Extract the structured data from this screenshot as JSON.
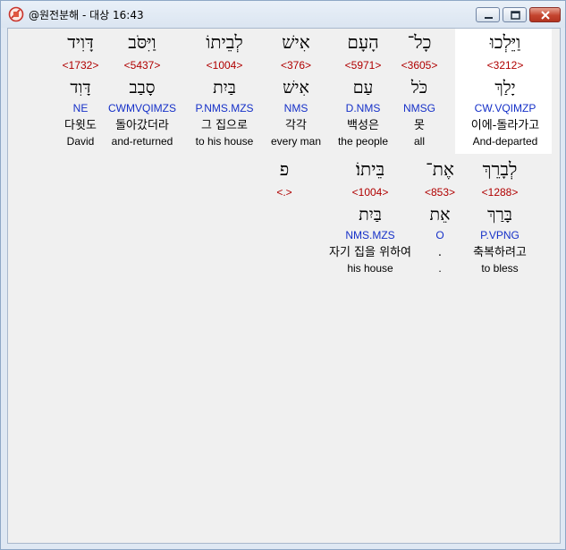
{
  "window": {
    "title": "@원전분해 - 대상 16:43",
    "app_icon": "bible-app-icon"
  },
  "rows": [
    {
      "words": [
        {
          "hebrew": "וַיֵּלְכוּ",
          "strong": "<3212>",
          "lemma": "יָלַךְ",
          "morph": "CW.VQIMZP",
          "korean": "이에-돌라가고",
          "english": "And-departed",
          "selected": true
        },
        {
          "hebrew": "כָל־",
          "strong": "<3605>",
          "lemma": "כֹּל",
          "morph": "NMSG",
          "korean": "못",
          "english": "all"
        },
        {
          "hebrew": "הָעָם",
          "strong": "<5971>",
          "lemma": "עַם",
          "morph": "D.NMS",
          "korean": "백성은",
          "english": "the people"
        },
        {
          "hebrew": "אִישׁ",
          "strong": "<376>",
          "lemma": "אִישׁ",
          "morph": "NMS",
          "korean": "각각",
          "english": "every man"
        },
        {
          "hebrew": "לְבֵיתוֹ",
          "strong": "<1004>",
          "lemma": "בַּיִת",
          "morph": "P.NMS.MZS",
          "korean": "그 집으로",
          "english": "to his house"
        },
        {
          "hebrew": "וַיִּסֹּב",
          "strong": "<5437>",
          "lemma": "סָבַב",
          "morph": "CWMVQIMZS",
          "korean": "돌아갔더라",
          "english": "and-returned"
        },
        {
          "hebrew": "דָּוִיד",
          "strong": "<1732>",
          "lemma": "דָּוִד",
          "morph": "NE",
          "korean": "다윗도",
          "english": "David"
        }
      ]
    },
    {
      "words": [
        {
          "hebrew": "לְבָרֵךְ",
          "strong": "<1288>",
          "lemma": "בָּרַךְ",
          "morph": "P.VPNG",
          "korean": "축복하려고",
          "english": "to bless"
        },
        {
          "hebrew": "אֶת־",
          "strong": "<853>",
          "lemma": "אֵת",
          "morph": "O",
          "korean": ".",
          "english": "."
        },
        {
          "hebrew": "בֵּיתוֹ׃",
          "strong": "<1004>",
          "lemma": "בַּיִת",
          "morph": "NMS.MZS",
          "korean": "자기 집을 위하여",
          "english": "his house"
        },
        {
          "hebrew": "פ",
          "strong": "<.>",
          "lemma": "",
          "morph": "",
          "korean": "",
          "english": ""
        }
      ]
    }
  ]
}
